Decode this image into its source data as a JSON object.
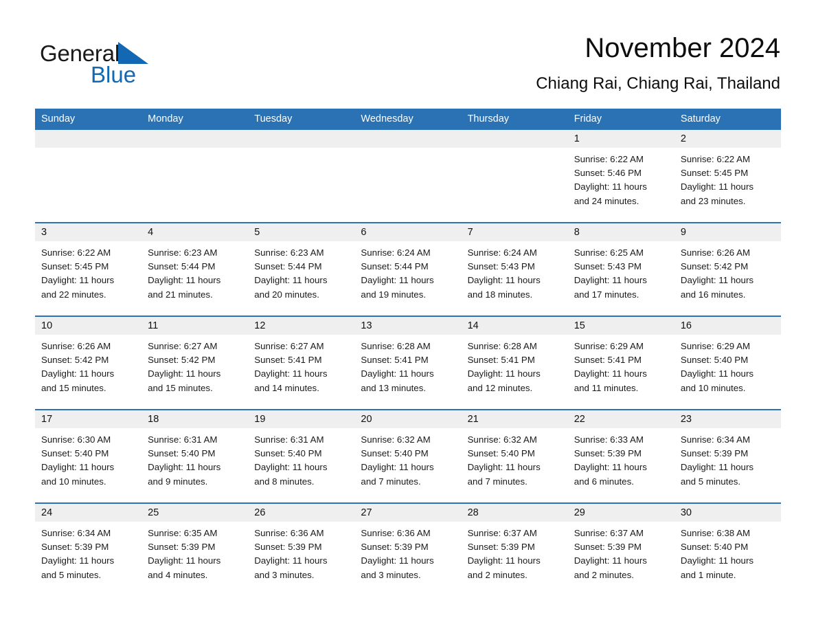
{
  "brand": {
    "name_dark": "General",
    "name_light": "Blue",
    "triangle_icon": "triangle-icon",
    "accent_color": "#1268b3"
  },
  "header": {
    "month_title": "November 2024",
    "location": "Chiang Rai, Chiang Rai, Thailand"
  },
  "theme": {
    "header_blue": "#2b72b5",
    "daynum_band": "#efefef",
    "row_divider": "#2b72b5",
    "text": "#1a1a1a"
  },
  "calendar": {
    "weekdays": [
      "Sunday",
      "Monday",
      "Tuesday",
      "Wednesday",
      "Thursday",
      "Friday",
      "Saturday"
    ],
    "weeks": [
      [
        {
          "day": "",
          "lines": []
        },
        {
          "day": "",
          "lines": []
        },
        {
          "day": "",
          "lines": []
        },
        {
          "day": "",
          "lines": []
        },
        {
          "day": "",
          "lines": []
        },
        {
          "day": "1",
          "lines": [
            "Sunrise: 6:22 AM",
            "Sunset: 5:46 PM",
            "Daylight: 11 hours",
            "and 24 minutes."
          ]
        },
        {
          "day": "2",
          "lines": [
            "Sunrise: 6:22 AM",
            "Sunset: 5:45 PM",
            "Daylight: 11 hours",
            "and 23 minutes."
          ]
        }
      ],
      [
        {
          "day": "3",
          "lines": [
            "Sunrise: 6:22 AM",
            "Sunset: 5:45 PM",
            "Daylight: 11 hours",
            "and 22 minutes."
          ]
        },
        {
          "day": "4",
          "lines": [
            "Sunrise: 6:23 AM",
            "Sunset: 5:44 PM",
            "Daylight: 11 hours",
            "and 21 minutes."
          ]
        },
        {
          "day": "5",
          "lines": [
            "Sunrise: 6:23 AM",
            "Sunset: 5:44 PM",
            "Daylight: 11 hours",
            "and 20 minutes."
          ]
        },
        {
          "day": "6",
          "lines": [
            "Sunrise: 6:24 AM",
            "Sunset: 5:44 PM",
            "Daylight: 11 hours",
            "and 19 minutes."
          ]
        },
        {
          "day": "7",
          "lines": [
            "Sunrise: 6:24 AM",
            "Sunset: 5:43 PM",
            "Daylight: 11 hours",
            "and 18 minutes."
          ]
        },
        {
          "day": "8",
          "lines": [
            "Sunrise: 6:25 AM",
            "Sunset: 5:43 PM",
            "Daylight: 11 hours",
            "and 17 minutes."
          ]
        },
        {
          "day": "9",
          "lines": [
            "Sunrise: 6:26 AM",
            "Sunset: 5:42 PM",
            "Daylight: 11 hours",
            "and 16 minutes."
          ]
        }
      ],
      [
        {
          "day": "10",
          "lines": [
            "Sunrise: 6:26 AM",
            "Sunset: 5:42 PM",
            "Daylight: 11 hours",
            "and 15 minutes."
          ]
        },
        {
          "day": "11",
          "lines": [
            "Sunrise: 6:27 AM",
            "Sunset: 5:42 PM",
            "Daylight: 11 hours",
            "and 15 minutes."
          ]
        },
        {
          "day": "12",
          "lines": [
            "Sunrise: 6:27 AM",
            "Sunset: 5:41 PM",
            "Daylight: 11 hours",
            "and 14 minutes."
          ]
        },
        {
          "day": "13",
          "lines": [
            "Sunrise: 6:28 AM",
            "Sunset: 5:41 PM",
            "Daylight: 11 hours",
            "and 13 minutes."
          ]
        },
        {
          "day": "14",
          "lines": [
            "Sunrise: 6:28 AM",
            "Sunset: 5:41 PM",
            "Daylight: 11 hours",
            "and 12 minutes."
          ]
        },
        {
          "day": "15",
          "lines": [
            "Sunrise: 6:29 AM",
            "Sunset: 5:41 PM",
            "Daylight: 11 hours",
            "and 11 minutes."
          ]
        },
        {
          "day": "16",
          "lines": [
            "Sunrise: 6:29 AM",
            "Sunset: 5:40 PM",
            "Daylight: 11 hours",
            "and 10 minutes."
          ]
        }
      ],
      [
        {
          "day": "17",
          "lines": [
            "Sunrise: 6:30 AM",
            "Sunset: 5:40 PM",
            "Daylight: 11 hours",
            "and 10 minutes."
          ]
        },
        {
          "day": "18",
          "lines": [
            "Sunrise: 6:31 AM",
            "Sunset: 5:40 PM",
            "Daylight: 11 hours",
            "and 9 minutes."
          ]
        },
        {
          "day": "19",
          "lines": [
            "Sunrise: 6:31 AM",
            "Sunset: 5:40 PM",
            "Daylight: 11 hours",
            "and 8 minutes."
          ]
        },
        {
          "day": "20",
          "lines": [
            "Sunrise: 6:32 AM",
            "Sunset: 5:40 PM",
            "Daylight: 11 hours",
            "and 7 minutes."
          ]
        },
        {
          "day": "21",
          "lines": [
            "Sunrise: 6:32 AM",
            "Sunset: 5:40 PM",
            "Daylight: 11 hours",
            "and 7 minutes."
          ]
        },
        {
          "day": "22",
          "lines": [
            "Sunrise: 6:33 AM",
            "Sunset: 5:39 PM",
            "Daylight: 11 hours",
            "and 6 minutes."
          ]
        },
        {
          "day": "23",
          "lines": [
            "Sunrise: 6:34 AM",
            "Sunset: 5:39 PM",
            "Daylight: 11 hours",
            "and 5 minutes."
          ]
        }
      ],
      [
        {
          "day": "24",
          "lines": [
            "Sunrise: 6:34 AM",
            "Sunset: 5:39 PM",
            "Daylight: 11 hours",
            "and 5 minutes."
          ]
        },
        {
          "day": "25",
          "lines": [
            "Sunrise: 6:35 AM",
            "Sunset: 5:39 PM",
            "Daylight: 11 hours",
            "and 4 minutes."
          ]
        },
        {
          "day": "26",
          "lines": [
            "Sunrise: 6:36 AM",
            "Sunset: 5:39 PM",
            "Daylight: 11 hours",
            "and 3 minutes."
          ]
        },
        {
          "day": "27",
          "lines": [
            "Sunrise: 6:36 AM",
            "Sunset: 5:39 PM",
            "Daylight: 11 hours",
            "and 3 minutes."
          ]
        },
        {
          "day": "28",
          "lines": [
            "Sunrise: 6:37 AM",
            "Sunset: 5:39 PM",
            "Daylight: 11 hours",
            "and 2 minutes."
          ]
        },
        {
          "day": "29",
          "lines": [
            "Sunrise: 6:37 AM",
            "Sunset: 5:39 PM",
            "Daylight: 11 hours",
            "and 2 minutes."
          ]
        },
        {
          "day": "30",
          "lines": [
            "Sunrise: 6:38 AM",
            "Sunset: 5:40 PM",
            "Daylight: 11 hours",
            "and 1 minute."
          ]
        }
      ]
    ]
  }
}
